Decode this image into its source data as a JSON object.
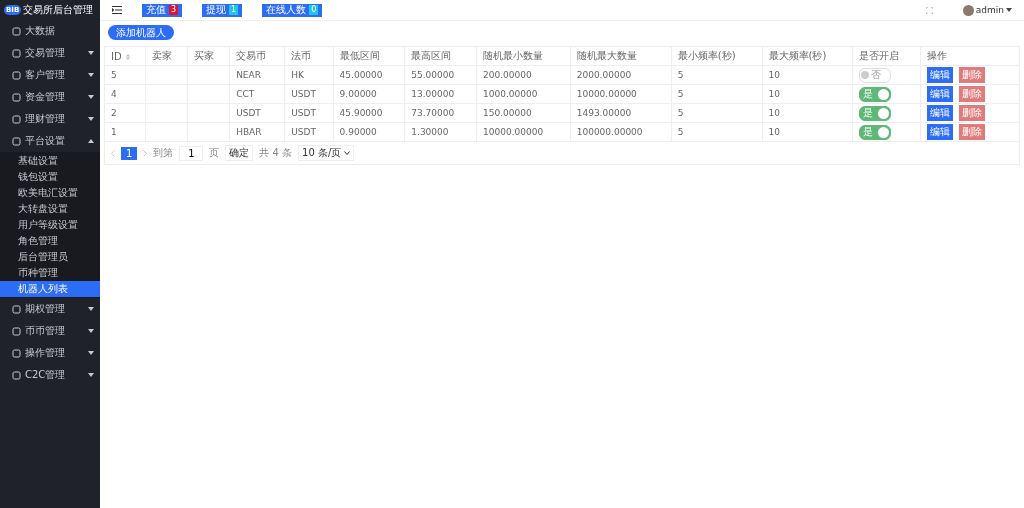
{
  "sidebar": {
    "logo": "BIB",
    "title": "交易所后台管理",
    "items": [
      {
        "label": "大数据",
        "has_caret": false
      },
      {
        "label": "交易管理",
        "expanded": false,
        "has_caret": true
      },
      {
        "label": "客户管理",
        "expanded": false,
        "has_caret": true
      },
      {
        "label": "资金管理",
        "expanded": false,
        "has_caret": true
      },
      {
        "label": "理财管理",
        "expanded": false,
        "has_caret": true
      },
      {
        "label": "平台设置",
        "expanded": true,
        "has_caret": true,
        "children": [
          {
            "label": "基础设置",
            "selected": false
          },
          {
            "label": "钱包设置",
            "selected": false
          },
          {
            "label": "欧美电汇设置",
            "selected": false
          },
          {
            "label": "大转盘设置",
            "selected": false
          },
          {
            "label": "用户等级设置",
            "selected": false
          },
          {
            "label": "角色管理",
            "selected": false
          },
          {
            "label": "后台管理员",
            "selected": false
          },
          {
            "label": "币种管理",
            "selected": false
          },
          {
            "label": "机器人列表",
            "selected": true
          }
        ]
      },
      {
        "label": "期权管理",
        "expanded": false,
        "has_caret": true
      },
      {
        "label": "币币管理",
        "expanded": false,
        "has_caret": true
      },
      {
        "label": "操作管理",
        "expanded": false,
        "has_caret": true
      },
      {
        "label": "C2C管理",
        "expanded": false,
        "has_caret": true
      }
    ]
  },
  "header": {
    "badges": [
      {
        "label": "充值",
        "count": "3",
        "color": "#e0142a"
      },
      {
        "label": "提现",
        "count": "1",
        "color": "#1ec8e0"
      },
      {
        "label": "在线人数",
        "count": "0",
        "color": "#1ec8e0"
      }
    ],
    "user": "admin"
  },
  "add_button": "添加机器人",
  "table": {
    "columns": [
      "ID",
      "卖家",
      "买家",
      "交易币",
      "法币",
      "最低区间",
      "最高区间",
      "随机最小数量",
      "随机最大数量",
      "最小频率(秒)",
      "最大频率(秒)",
      "是否开启",
      "操作"
    ],
    "rows": [
      {
        "cells": [
          "5",
          "",
          "",
          "NEAR",
          "HK",
          "45.00000",
          "55.00000",
          "200.00000",
          "2000.00000",
          "5",
          "10"
        ],
        "enabled": false,
        "switch_text": "否",
        "actions": [
          "编辑",
          "删除"
        ]
      },
      {
        "cells": [
          "4",
          "",
          "",
          "CCT",
          "USDT",
          "9.00000",
          "13.00000",
          "1000.00000",
          "10000.00000",
          "5",
          "10"
        ],
        "enabled": true,
        "switch_text": "是",
        "actions": [
          "编辑",
          "删除"
        ]
      },
      {
        "cells": [
          "2",
          "",
          "",
          "USDT",
          "USDT",
          "45.90000",
          "73.70000",
          "150.00000",
          "1493.00000",
          "5",
          "10"
        ],
        "enabled": true,
        "switch_text": "是",
        "actions": [
          "编辑",
          "删除"
        ]
      },
      {
        "cells": [
          "1",
          "",
          "",
          "HBAR",
          "USDT",
          "0.90000",
          "1.30000",
          "10000.00000",
          "100000.00000",
          "5",
          "10"
        ],
        "enabled": true,
        "switch_text": "是",
        "actions": [
          "编辑",
          "删除"
        ]
      }
    ]
  },
  "pagination": {
    "pages": [
      {
        "label": "1",
        "selected": true
      }
    ],
    "goto_label": "到第",
    "page_value": "1",
    "page_unit": "页",
    "confirm": "确定",
    "total": "共 4 条",
    "page_size": "10 条/页"
  }
}
